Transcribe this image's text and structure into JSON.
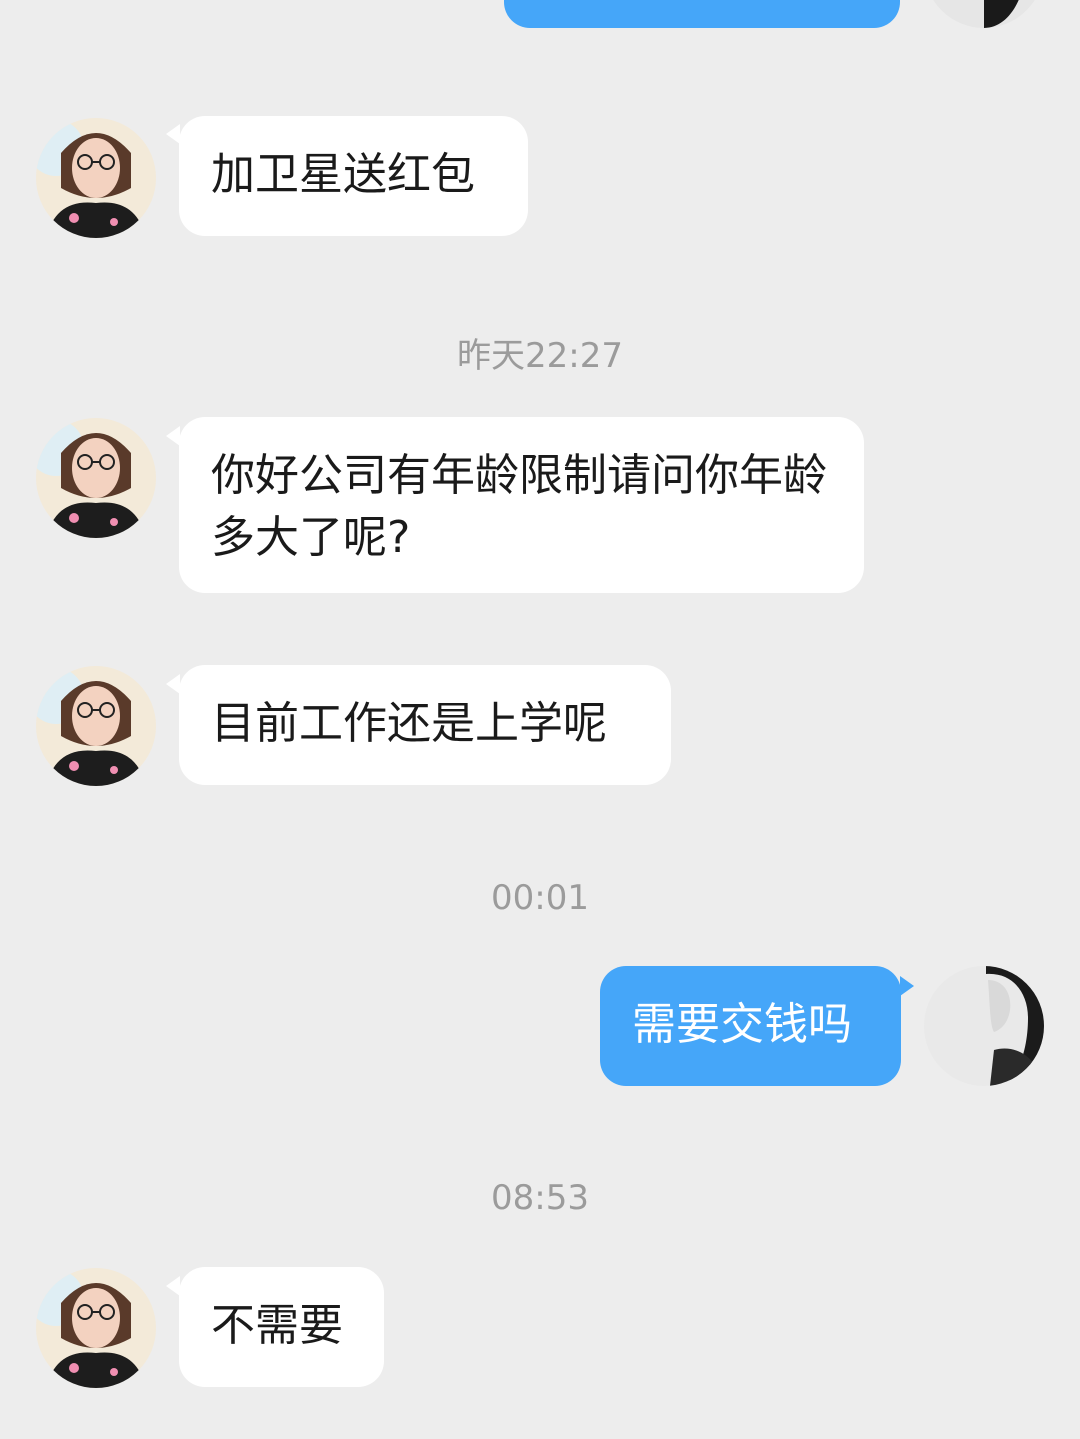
{
  "colors": {
    "background": "#ededed",
    "incoming_bubble": "#ffffff",
    "outgoing_bubble": "#45a6f9",
    "timestamp": "#9b9b9b"
  },
  "messages": [
    {
      "from": "other",
      "text": "加卫星送红包"
    },
    {
      "from": "other",
      "text": "你好公司有年龄限制请问你年龄多大了呢?"
    },
    {
      "from": "other",
      "text": "目前工作还是上学呢"
    },
    {
      "from": "me",
      "text": "需要交钱吗"
    },
    {
      "from": "other",
      "text": "不需要"
    }
  ],
  "timestamps": [
    "昨天22:27",
    "00:01",
    "08:53"
  ],
  "avatars": {
    "other": "woman-with-glasses-avatar",
    "me": "grayscale-portrait-avatar"
  }
}
